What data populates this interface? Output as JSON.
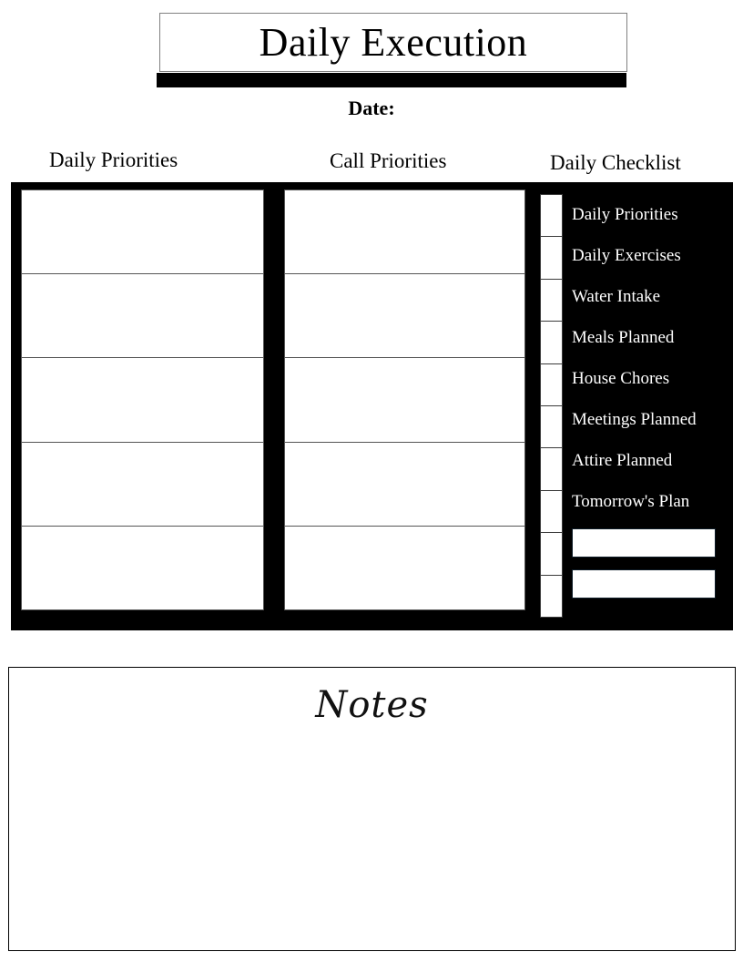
{
  "page": {
    "title": "Daily Execution",
    "date_label": "Date:"
  },
  "headers": {
    "daily_priorities": "Daily Priorities",
    "call_priorities": "Call Priorities",
    "daily_checklist": "Daily Checklist"
  },
  "daily_priorities": {
    "rows": [
      "",
      "",
      "",
      "",
      ""
    ]
  },
  "call_priorities": {
    "rows": [
      "",
      "",
      "",
      "",
      ""
    ]
  },
  "checklist": {
    "checkbox_count": 10,
    "items": [
      "Daily Priorities",
      "Daily Exercises",
      "Water Intake",
      "Meals Planned",
      "House Chores",
      "Meetings Planned",
      "Attire Planned",
      "Tomorrow's Plan"
    ],
    "blank_fields": [
      "",
      ""
    ]
  },
  "notes": {
    "title": "Notes",
    "content": ""
  },
  "colors": {
    "panel": "#000000",
    "paper": "#ffffff",
    "rule": "#555555",
    "blank_border": "#0d1b26"
  }
}
